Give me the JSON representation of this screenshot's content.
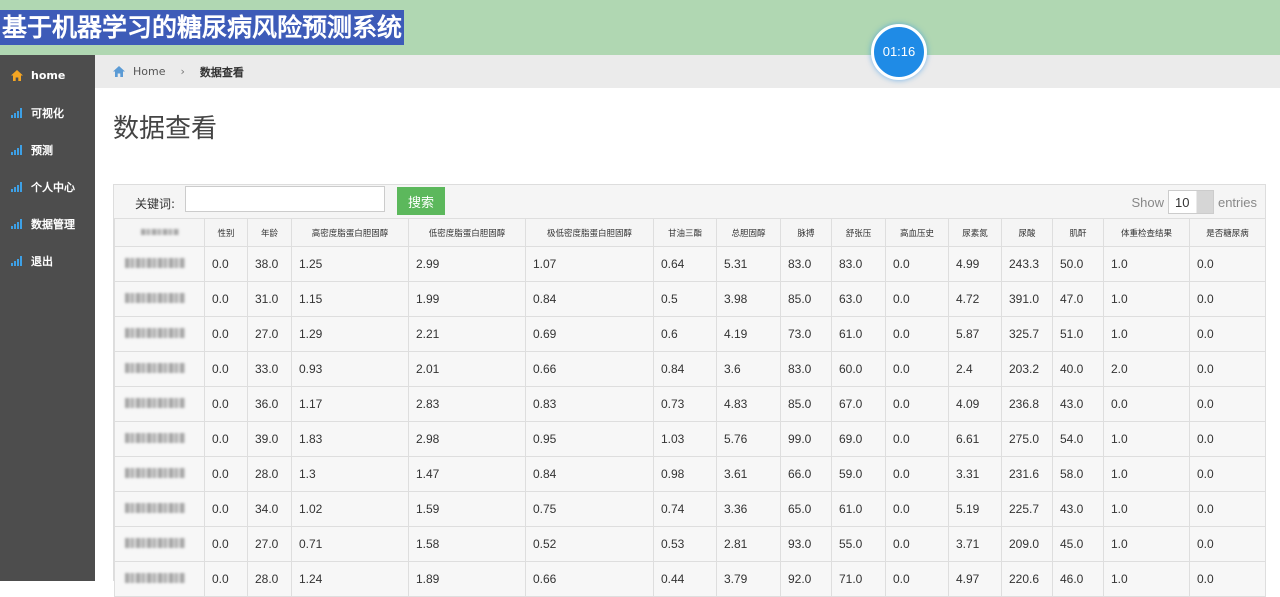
{
  "app": {
    "title": "基于机器学习的糖尿病风险预测系统",
    "timer": "01:16"
  },
  "sidebar": {
    "items": [
      {
        "label": "home",
        "icon": "home-icon"
      },
      {
        "label": "可视化",
        "icon": "bar-chart-icon"
      },
      {
        "label": "预测",
        "icon": "bar-chart-icon"
      },
      {
        "label": "个人中心",
        "icon": "bar-chart-icon"
      },
      {
        "label": "数据管理",
        "icon": "bar-chart-icon"
      },
      {
        "label": "退出",
        "icon": "bar-chart-icon"
      }
    ]
  },
  "breadcrumb": {
    "home": "Home",
    "current": "数据查看"
  },
  "page": {
    "title": "数据查看"
  },
  "search": {
    "label": "关键词:",
    "value": "",
    "button": "搜索"
  },
  "pagination": {
    "show_label": "Show",
    "page_size": "10",
    "entries_label": "entries"
  },
  "table": {
    "columns": [
      "",
      "性别",
      "年龄",
      "高密度脂蛋白胆固醇",
      "低密度脂蛋白胆固醇",
      "极低密度脂蛋白胆固醇",
      "甘油三酯",
      "总胆固醇",
      "脉搏",
      "舒张压",
      "高血压史",
      "尿素氮",
      "尿酸",
      "肌酐",
      "体重检查结果",
      "是否糖尿病"
    ],
    "rows": [
      [
        "",
        "0.0",
        "38.0",
        "1.25",
        "2.99",
        "1.07",
        "0.64",
        "5.31",
        "83.0",
        "83.0",
        "0.0",
        "4.99",
        "243.3",
        "50.0",
        "1.0",
        "0.0"
      ],
      [
        "",
        "0.0",
        "31.0",
        "1.15",
        "1.99",
        "0.84",
        "0.5",
        "3.98",
        "85.0",
        "63.0",
        "0.0",
        "4.72",
        "391.0",
        "47.0",
        "1.0",
        "0.0"
      ],
      [
        "",
        "0.0",
        "27.0",
        "1.29",
        "2.21",
        "0.69",
        "0.6",
        "4.19",
        "73.0",
        "61.0",
        "0.0",
        "5.87",
        "325.7",
        "51.0",
        "1.0",
        "0.0"
      ],
      [
        "",
        "0.0",
        "33.0",
        "0.93",
        "2.01",
        "0.66",
        "0.84",
        "3.6",
        "83.0",
        "60.0",
        "0.0",
        "2.4",
        "203.2",
        "40.0",
        "2.0",
        "0.0"
      ],
      [
        "",
        "0.0",
        "36.0",
        "1.17",
        "2.83",
        "0.83",
        "0.73",
        "4.83",
        "85.0",
        "67.0",
        "0.0",
        "4.09",
        "236.8",
        "43.0",
        "0.0",
        "0.0"
      ],
      [
        "",
        "0.0",
        "39.0",
        "1.83",
        "2.98",
        "0.95",
        "1.03",
        "5.76",
        "99.0",
        "69.0",
        "0.0",
        "6.61",
        "275.0",
        "54.0",
        "1.0",
        "0.0"
      ],
      [
        "",
        "0.0",
        "28.0",
        "1.3",
        "1.47",
        "0.84",
        "0.98",
        "3.61",
        "66.0",
        "59.0",
        "0.0",
        "3.31",
        "231.6",
        "58.0",
        "1.0",
        "0.0"
      ],
      [
        "",
        "0.0",
        "34.0",
        "1.02",
        "1.59",
        "0.75",
        "0.74",
        "3.36",
        "65.0",
        "61.0",
        "0.0",
        "5.19",
        "225.7",
        "43.0",
        "1.0",
        "0.0"
      ],
      [
        "",
        "0.0",
        "27.0",
        "0.71",
        "1.58",
        "0.52",
        "0.53",
        "2.81",
        "93.0",
        "55.0",
        "0.0",
        "3.71",
        "209.0",
        "45.0",
        "1.0",
        "0.0"
      ],
      [
        "",
        "0.0",
        "28.0",
        "1.24",
        "1.89",
        "0.66",
        "0.44",
        "3.79",
        "92.0",
        "71.0",
        "0.0",
        "4.97",
        "220.6",
        "46.0",
        "1.0",
        "0.0"
      ]
    ]
  },
  "colors": {
    "header_bg": "#b0d7b2",
    "title_highlight": "#3d5bb8",
    "sidebar_bg": "#4d4d4d",
    "accent_orange": "#f5a623",
    "accent_blue": "#3da0e6",
    "search_button": "#5cb85c"
  }
}
